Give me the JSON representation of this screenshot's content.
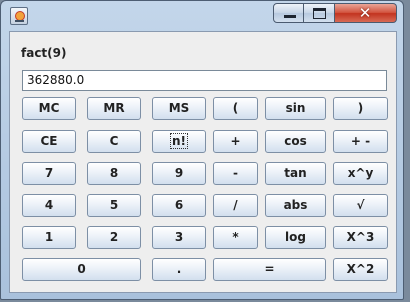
{
  "window": {
    "close_glyph": "✕",
    "expression": "fact(9)",
    "display_value": "362880.0"
  },
  "keys": {
    "mc": "MC",
    "mr": "MR",
    "ms": "MS",
    "lparen": "(",
    "sin": "sin",
    "rparen": ")",
    "ce": "CE",
    "c": "C",
    "fact": "n!",
    "plus": "+",
    "cos": "cos",
    "negate": "+ -",
    "seven": "7",
    "eight": "8",
    "nine": "9",
    "minus": "-",
    "tan": "tan",
    "power": "x^y",
    "four": "4",
    "five": "5",
    "six": "6",
    "divide": "/",
    "abs": "abs",
    "sqrt": "√",
    "one": "1",
    "two": "2",
    "three": "3",
    "multiply": "*",
    "log": "log",
    "cube": "X^3",
    "zero": "0",
    "dot": ".",
    "equals": "=",
    "square": "X^2"
  },
  "focused_key": "n!"
}
